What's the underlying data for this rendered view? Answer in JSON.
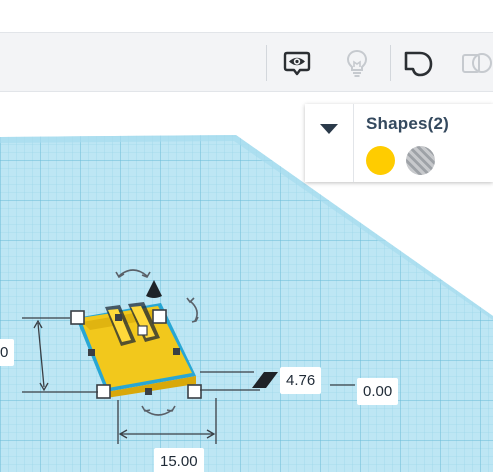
{
  "toolbar": {
    "buttons": [
      {
        "name": "notes-icon"
      },
      {
        "name": "hint-lightbulb-icon"
      },
      {
        "name": "shape-tool-icon"
      },
      {
        "name": "duplicate-shape-icon"
      }
    ]
  },
  "shapes_panel": {
    "title": "Shapes(2)",
    "swatches": [
      {
        "name": "solid-color-swatch",
        "color": "#ffcc00"
      },
      {
        "name": "hole-swatch",
        "color": "#b0b3b8"
      }
    ]
  },
  "dimensions": {
    "width": "15.00",
    "height": "4.76",
    "elevation": "0.00",
    "length_partial": "0"
  },
  "colors": {
    "workplane": "#b9e5f3",
    "grid_line": "#7ec4dd",
    "shape": "#f5cf2a",
    "selection": "#1aa6d6"
  }
}
